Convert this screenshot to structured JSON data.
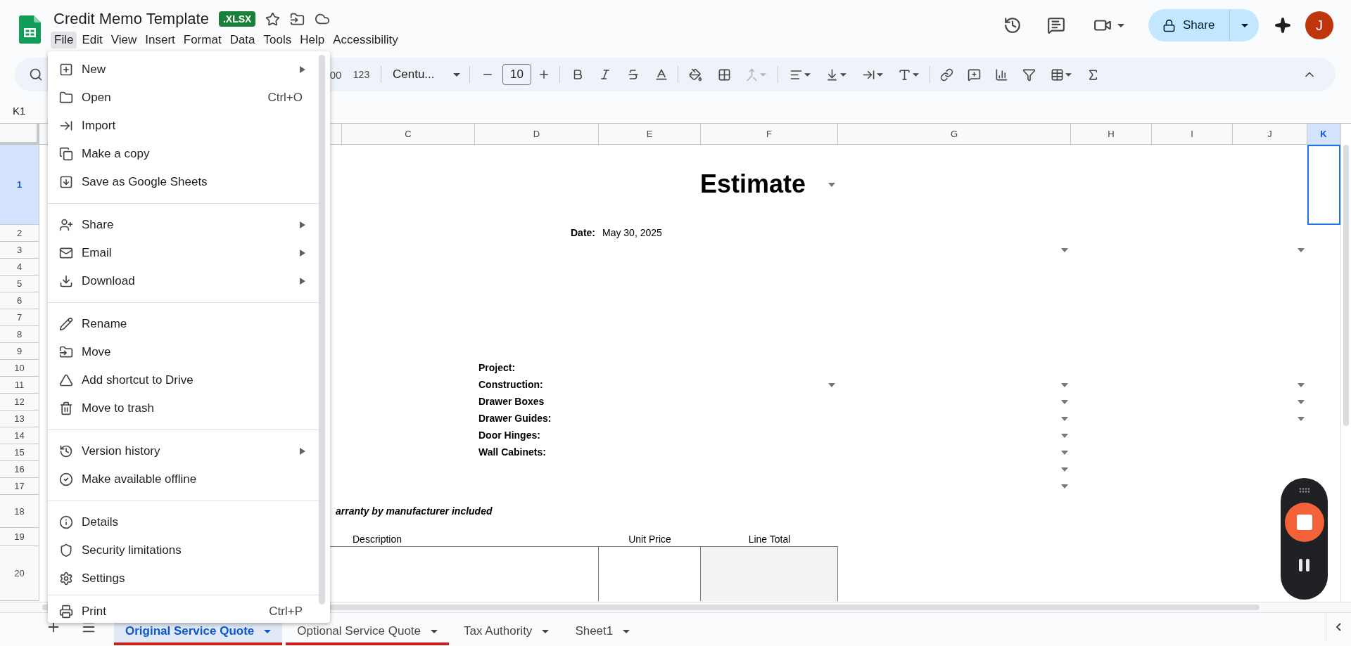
{
  "app": {
    "title": "Credit Memo Template",
    "file_badge": ".XLSX"
  },
  "menubar": [
    {
      "label": "File",
      "selected": true
    },
    {
      "label": "Edit",
      "selected": false
    },
    {
      "label": "View",
      "selected": false
    },
    {
      "label": "Insert",
      "selected": false
    },
    {
      "label": "Format",
      "selected": false
    },
    {
      "label": "Data",
      "selected": false
    },
    {
      "label": "Tools",
      "selected": false
    },
    {
      "label": "Help",
      "selected": false
    },
    {
      "label": "Accessibility",
      "selected": false
    }
  ],
  "share_button": "Share",
  "avatar": "J",
  "toolbar": {
    "decimal_partial": "00",
    "number_format": "123",
    "font": "Centu...",
    "font_size": "10"
  },
  "name_box": "K1",
  "columns": [
    {
      "letter": "C",
      "selected": false
    },
    {
      "letter": "D",
      "selected": false
    },
    {
      "letter": "E",
      "selected": false
    },
    {
      "letter": "F",
      "selected": false
    },
    {
      "letter": "G",
      "selected": false
    },
    {
      "letter": "H",
      "selected": false
    },
    {
      "letter": "I",
      "selected": false
    },
    {
      "letter": "J",
      "selected": false
    },
    {
      "letter": "K",
      "selected": true
    }
  ],
  "rows": [
    {
      "number": "1",
      "selected": true,
      "cells": {
        "F": {
          "kind": "title",
          "text": "Estimate",
          "dropdown": true
        }
      }
    },
    {
      "number": "2",
      "selected": false,
      "cells": {
        "D": {
          "kind": "field-label",
          "text": "Date:",
          "dropdown": false
        },
        "E": {
          "kind": "value",
          "text": "May 30, 2025",
          "dropdown": false
        }
      }
    },
    {
      "number": "3",
      "selected": false,
      "cells": {
        "G": {
          "kind": "empty",
          "dropdown": true
        },
        "J": {
          "kind": "empty",
          "dropdown": true
        }
      }
    },
    {
      "number": "4",
      "selected": false
    },
    {
      "number": "5",
      "selected": false
    },
    {
      "number": "6",
      "selected": false
    },
    {
      "number": "7",
      "selected": false
    },
    {
      "number": "8",
      "selected": false
    },
    {
      "number": "9",
      "selected": false
    },
    {
      "number": "10",
      "selected": false,
      "cells": {
        "D": {
          "kind": "label",
          "text": "Project:",
          "dropdown": false
        }
      }
    },
    {
      "number": "11",
      "selected": false,
      "cells": {
        "D": {
          "kind": "label",
          "text": "Construction:",
          "dropdown": false
        },
        "F": {
          "kind": "empty",
          "dropdown": true
        },
        "G": {
          "kind": "empty",
          "dropdown": true
        },
        "J": {
          "kind": "empty",
          "dropdown": true
        }
      }
    },
    {
      "number": "12",
      "selected": false,
      "cells": {
        "D": {
          "kind": "label",
          "text": "Drawer Boxes",
          "dropdown": false
        },
        "G": {
          "kind": "empty",
          "dropdown": true
        },
        "J": {
          "kind": "empty",
          "dropdown": true
        }
      }
    },
    {
      "number": "13",
      "selected": false,
      "cells": {
        "D": {
          "kind": "label",
          "text": "Drawer Guides:",
          "dropdown": false
        },
        "G": {
          "kind": "empty",
          "dropdown": true
        },
        "J": {
          "kind": "empty",
          "dropdown": true
        }
      }
    },
    {
      "number": "14",
      "selected": false,
      "cells": {
        "D": {
          "kind": "label",
          "text": "Door Hinges:",
          "dropdown": false
        },
        "G": {
          "kind": "empty",
          "dropdown": true
        }
      }
    },
    {
      "number": "15",
      "selected": false,
      "cells": {
        "D": {
          "kind": "label",
          "text": "Wall Cabinets:",
          "dropdown": false
        },
        "G": {
          "kind": "empty",
          "dropdown": true
        }
      }
    },
    {
      "number": "16",
      "selected": false,
      "cells": {
        "G": {
          "kind": "empty",
          "dropdown": true
        }
      }
    },
    {
      "number": "17",
      "selected": false,
      "cells": {
        "G": {
          "kind": "empty",
          "dropdown": true
        }
      }
    },
    {
      "number": "18",
      "selected": false,
      "cells": {
        "C": {
          "kind": "note",
          "text": "arranty by manufacturer included",
          "dropdown": false
        }
      }
    },
    {
      "number": "19",
      "selected": false,
      "cells": {
        "B": {
          "kind": "wide-heading",
          "text": "Description",
          "dropdown": false
        },
        "E": {
          "kind": "column-heading",
          "text": "Unit Price",
          "dropdown": false
        },
        "F": {
          "kind": "column-heading",
          "text": "Line Total",
          "dropdown": false
        }
      }
    },
    {
      "number": "20",
      "selected": false,
      "cells": {
        "B": {
          "kind": "rule",
          "dropdown": false
        },
        "E": {
          "kind": "box",
          "dropdown": false
        },
        "F": {
          "kind": "shaded-box",
          "dropdown": false
        }
      }
    }
  ],
  "file_menu": [
    [
      {
        "label": "New",
        "has_submenu": true
      },
      {
        "label": "Open",
        "shortcut": "Ctrl+O",
        "has_submenu": false
      },
      {
        "label": "Import",
        "has_submenu": false
      },
      {
        "label": "Make a copy",
        "has_submenu": false
      },
      {
        "label": "Save as Google Sheets",
        "has_submenu": false
      }
    ],
    [
      {
        "label": "Share",
        "has_submenu": true
      },
      {
        "label": "Email",
        "has_submenu": true
      },
      {
        "label": "Download",
        "has_submenu": true
      }
    ],
    [
      {
        "label": "Rename",
        "has_submenu": false
      },
      {
        "label": "Move",
        "has_submenu": false
      },
      {
        "label": "Add shortcut to Drive",
        "has_submenu": false
      },
      {
        "label": "Move to trash",
        "has_submenu": false
      }
    ],
    [
      {
        "label": "Version history",
        "has_submenu": true
      },
      {
        "label": "Make available offline",
        "has_submenu": false
      }
    ],
    [
      {
        "label": "Details",
        "has_submenu": false
      },
      {
        "label": "Security limitations",
        "has_submenu": false
      },
      {
        "label": "Settings",
        "has_submenu": false
      }
    ],
    [
      {
        "label": "Print",
        "shortcut": "Ctrl+P",
        "has_submenu": false
      }
    ]
  ],
  "sheet_tabs": [
    {
      "label": "Original Service Quote",
      "selected": true,
      "color": "#c5221f"
    },
    {
      "label": "Optional Service Quote",
      "selected": false,
      "color": "#c5221f"
    },
    {
      "label": "Tax Authority",
      "selected": false
    },
    {
      "label": "Sheet1",
      "selected": false
    }
  ]
}
